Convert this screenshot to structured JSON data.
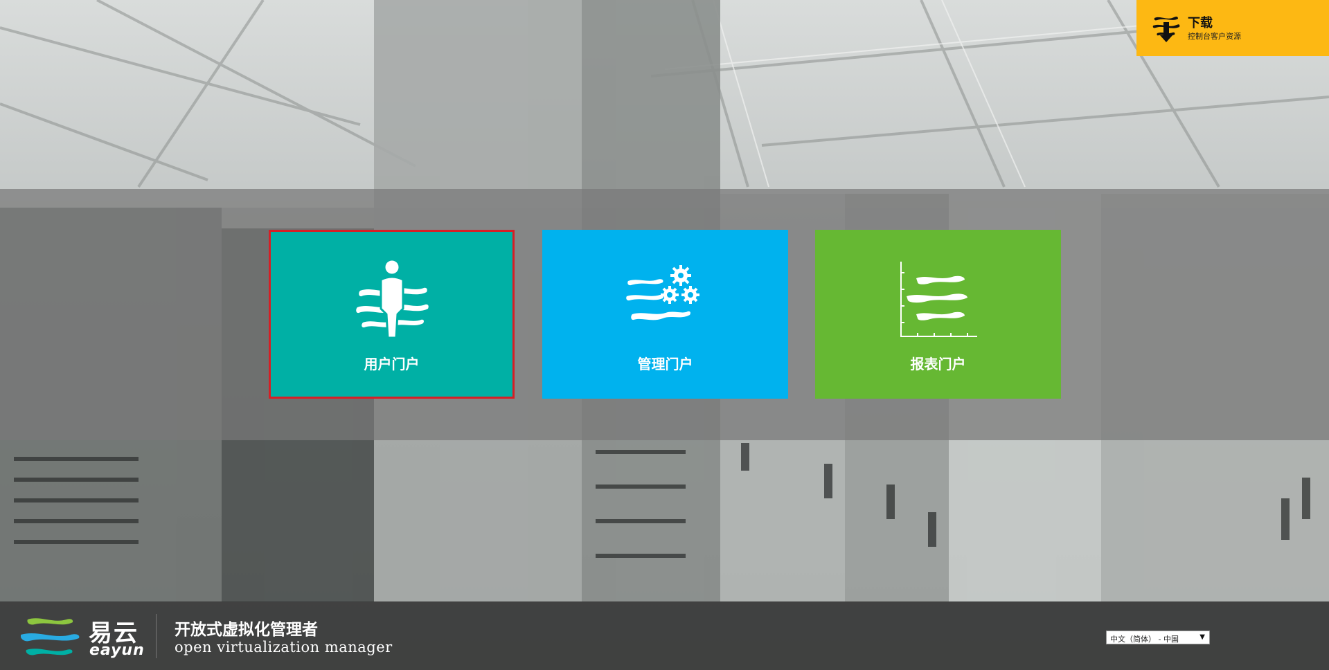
{
  "download": {
    "title": "下载",
    "subtitle": "控制台客户资源",
    "icon": "download-icon",
    "color": "#fdb813"
  },
  "portals": [
    {
      "label": "用户门户",
      "icon": "user-portal-icon",
      "color": "#00b0a5",
      "selected": true
    },
    {
      "label": "管理门户",
      "icon": "admin-portal-icon",
      "color": "#00b2ee",
      "selected": false
    },
    {
      "label": "报表门户",
      "icon": "report-portal-icon",
      "color": "#66b833",
      "selected": false
    }
  ],
  "footer": {
    "brand_cn": "易云",
    "brand_en": "eayun",
    "tagline_cn": "开放式虚拟化管理者",
    "tagline_en": "open virtualization manager",
    "language": "中文（简体） - 中国"
  },
  "colors": {
    "selected_border": "#d61f26",
    "logo_green": "#8dc63f",
    "logo_blue": "#29abe2",
    "logo_teal": "#00b0a5"
  }
}
